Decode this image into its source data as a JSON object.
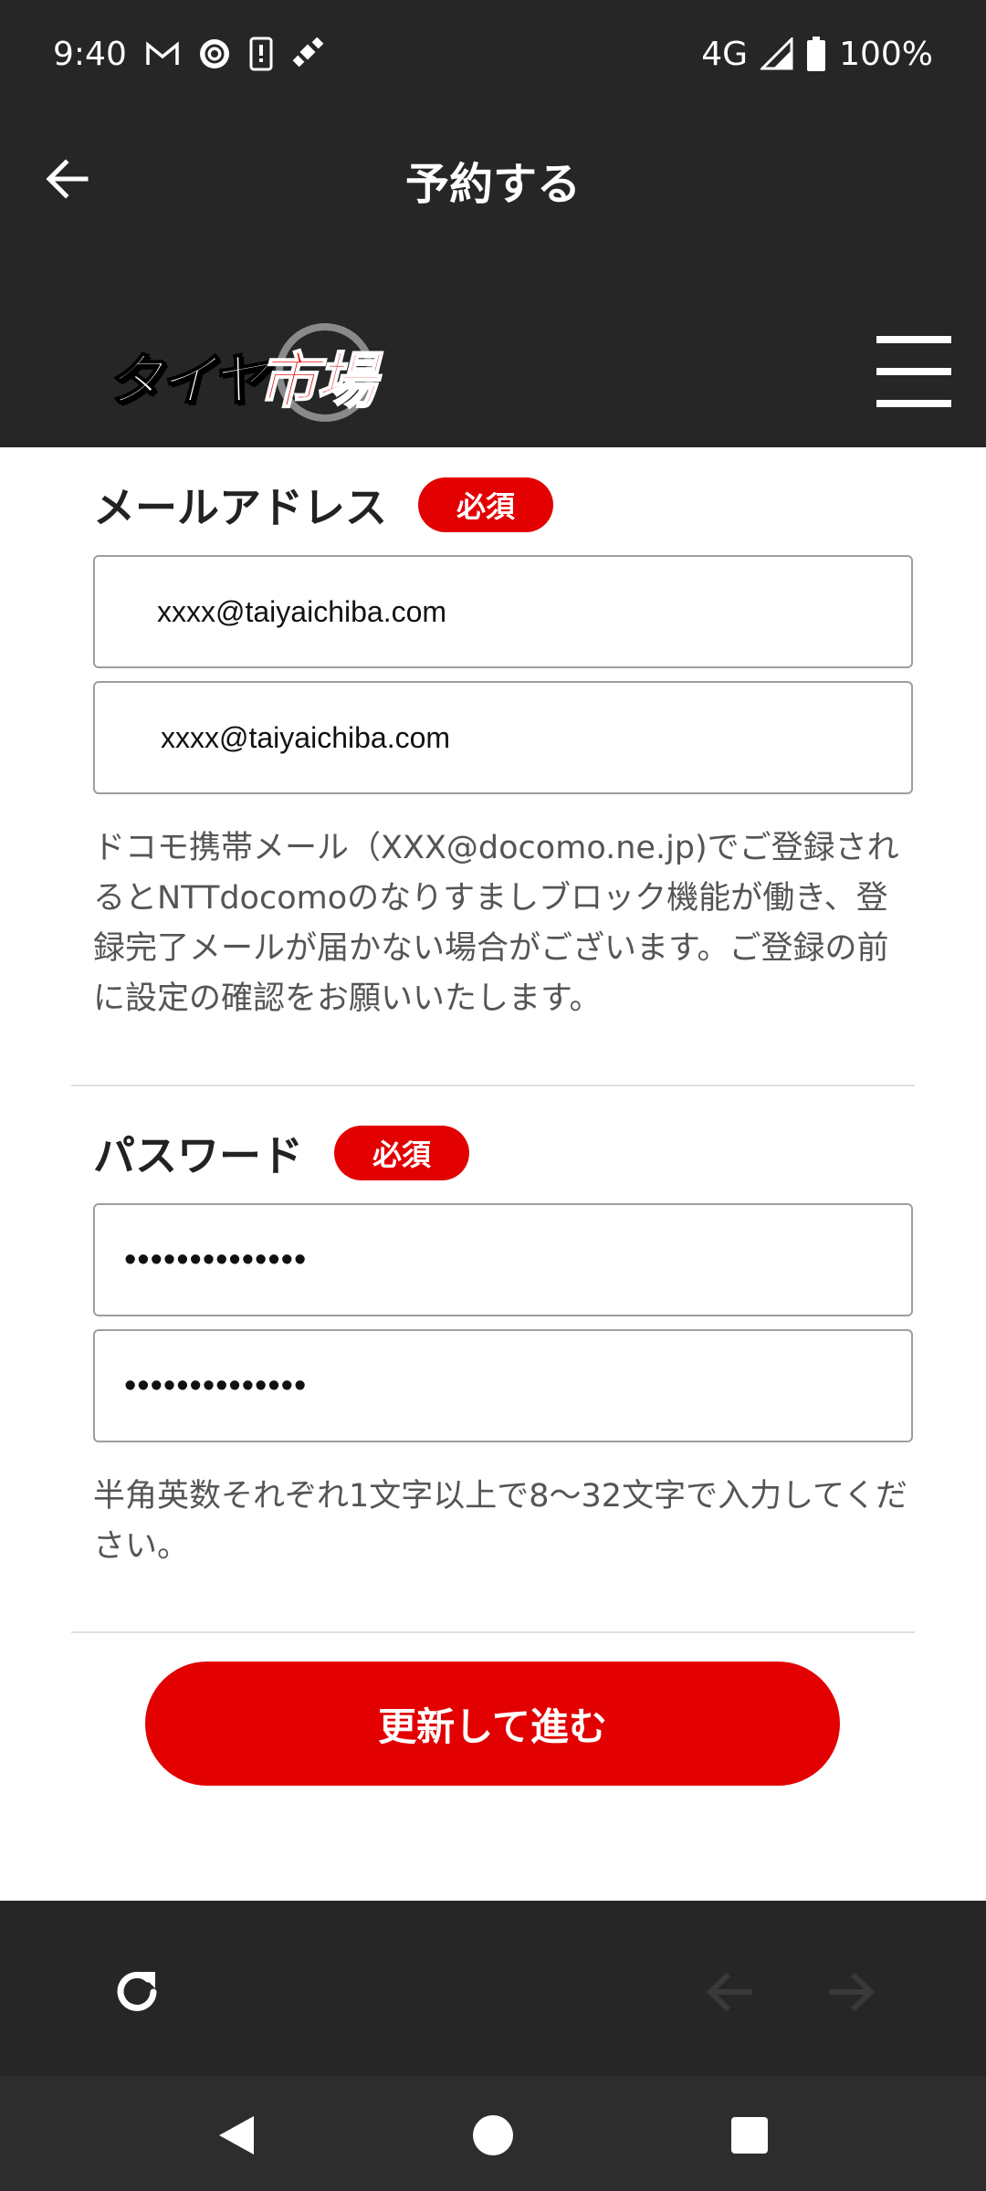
{
  "status_bar": {
    "time": "9:40",
    "network": "4G",
    "battery": "100%",
    "icons": [
      "gmail-icon",
      "camera-lens-icon",
      "phone-alert-icon",
      "satellite-icon",
      "signal-icon",
      "battery-icon"
    ]
  },
  "app_bar": {
    "title": "予約する",
    "back_icon": "arrow-left-icon"
  },
  "site_header": {
    "logo_text_part1": "タイヤ",
    "logo_text_part2": "市場",
    "menu_icon": "hamburger-menu-icon"
  },
  "email_section": {
    "label": "メールアドレス",
    "required_badge": "必須",
    "email_value": "xxxx@taiyaichiba.com",
    "email_confirm_value": "xxxx@taiyaichiba.com",
    "help_text": "ドコモ携帯メール（XXX@docomo.ne.jp)でご登録されるとNTTdocomoのなりすましブロック機能が働き、登録完了メールが届かない場合がございます。ご登録の前に設定の確認をお願いいたします。"
  },
  "password_section": {
    "label": "パスワード",
    "required_badge": "必須",
    "password_value": "••••••••••••••",
    "password_confirm_value": "••••••••••••••",
    "help_text": "半角英数それぞれ1文字以上で8〜32文字で入力してください。"
  },
  "submit": {
    "label": "更新して進む"
  },
  "browser_bar": {
    "icons": [
      "reload-icon",
      "back-arrow-icon",
      "forward-arrow-icon"
    ]
  },
  "system_nav": {
    "icons": [
      "nav-back-icon",
      "nav-home-icon",
      "nav-recents-icon"
    ]
  },
  "colors": {
    "dark_bar": "#262626",
    "accent_red": "#e20000",
    "text_dark": "#222222",
    "text_muted": "#555555"
  }
}
